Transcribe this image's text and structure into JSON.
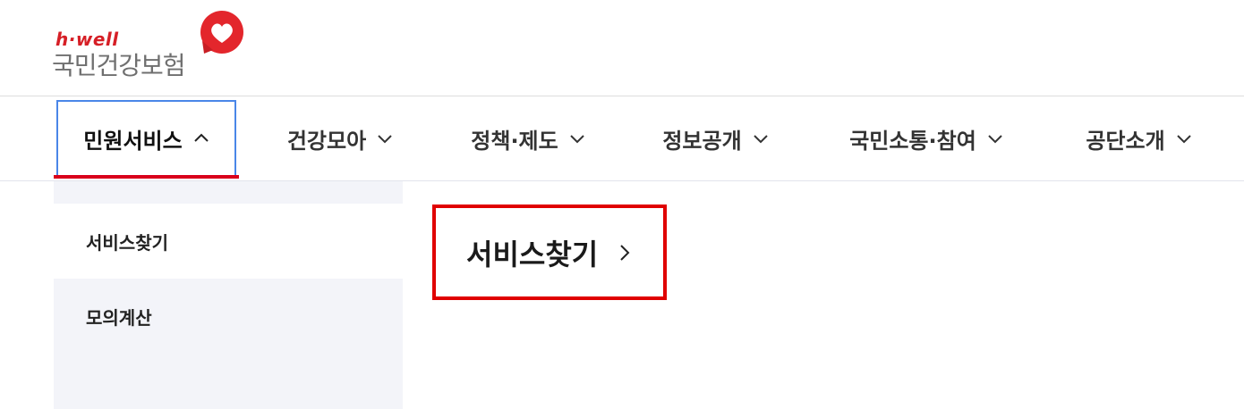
{
  "header": {
    "logo_brand": "h·well",
    "logo_org": "국민건강보험"
  },
  "nav": {
    "items": [
      {
        "label": "민원서비스",
        "expanded": true
      },
      {
        "label": "건강모아",
        "expanded": false
      },
      {
        "label": "정책·제도",
        "expanded": false
      },
      {
        "label": "정보공개",
        "expanded": false
      },
      {
        "label": "국민소통·참여",
        "expanded": false
      },
      {
        "label": "공단소개",
        "expanded": false
      }
    ]
  },
  "submenu": {
    "items": [
      {
        "label": "서비스찾기",
        "selected": true
      },
      {
        "label": "모의계산",
        "selected": false
      }
    ],
    "title": "서비스찾기"
  },
  "colors": {
    "brand_red": "#d61f26",
    "focus_blue": "#4a86e8",
    "highlight_red": "#e00000",
    "panel_bg": "#f3f4f9"
  }
}
